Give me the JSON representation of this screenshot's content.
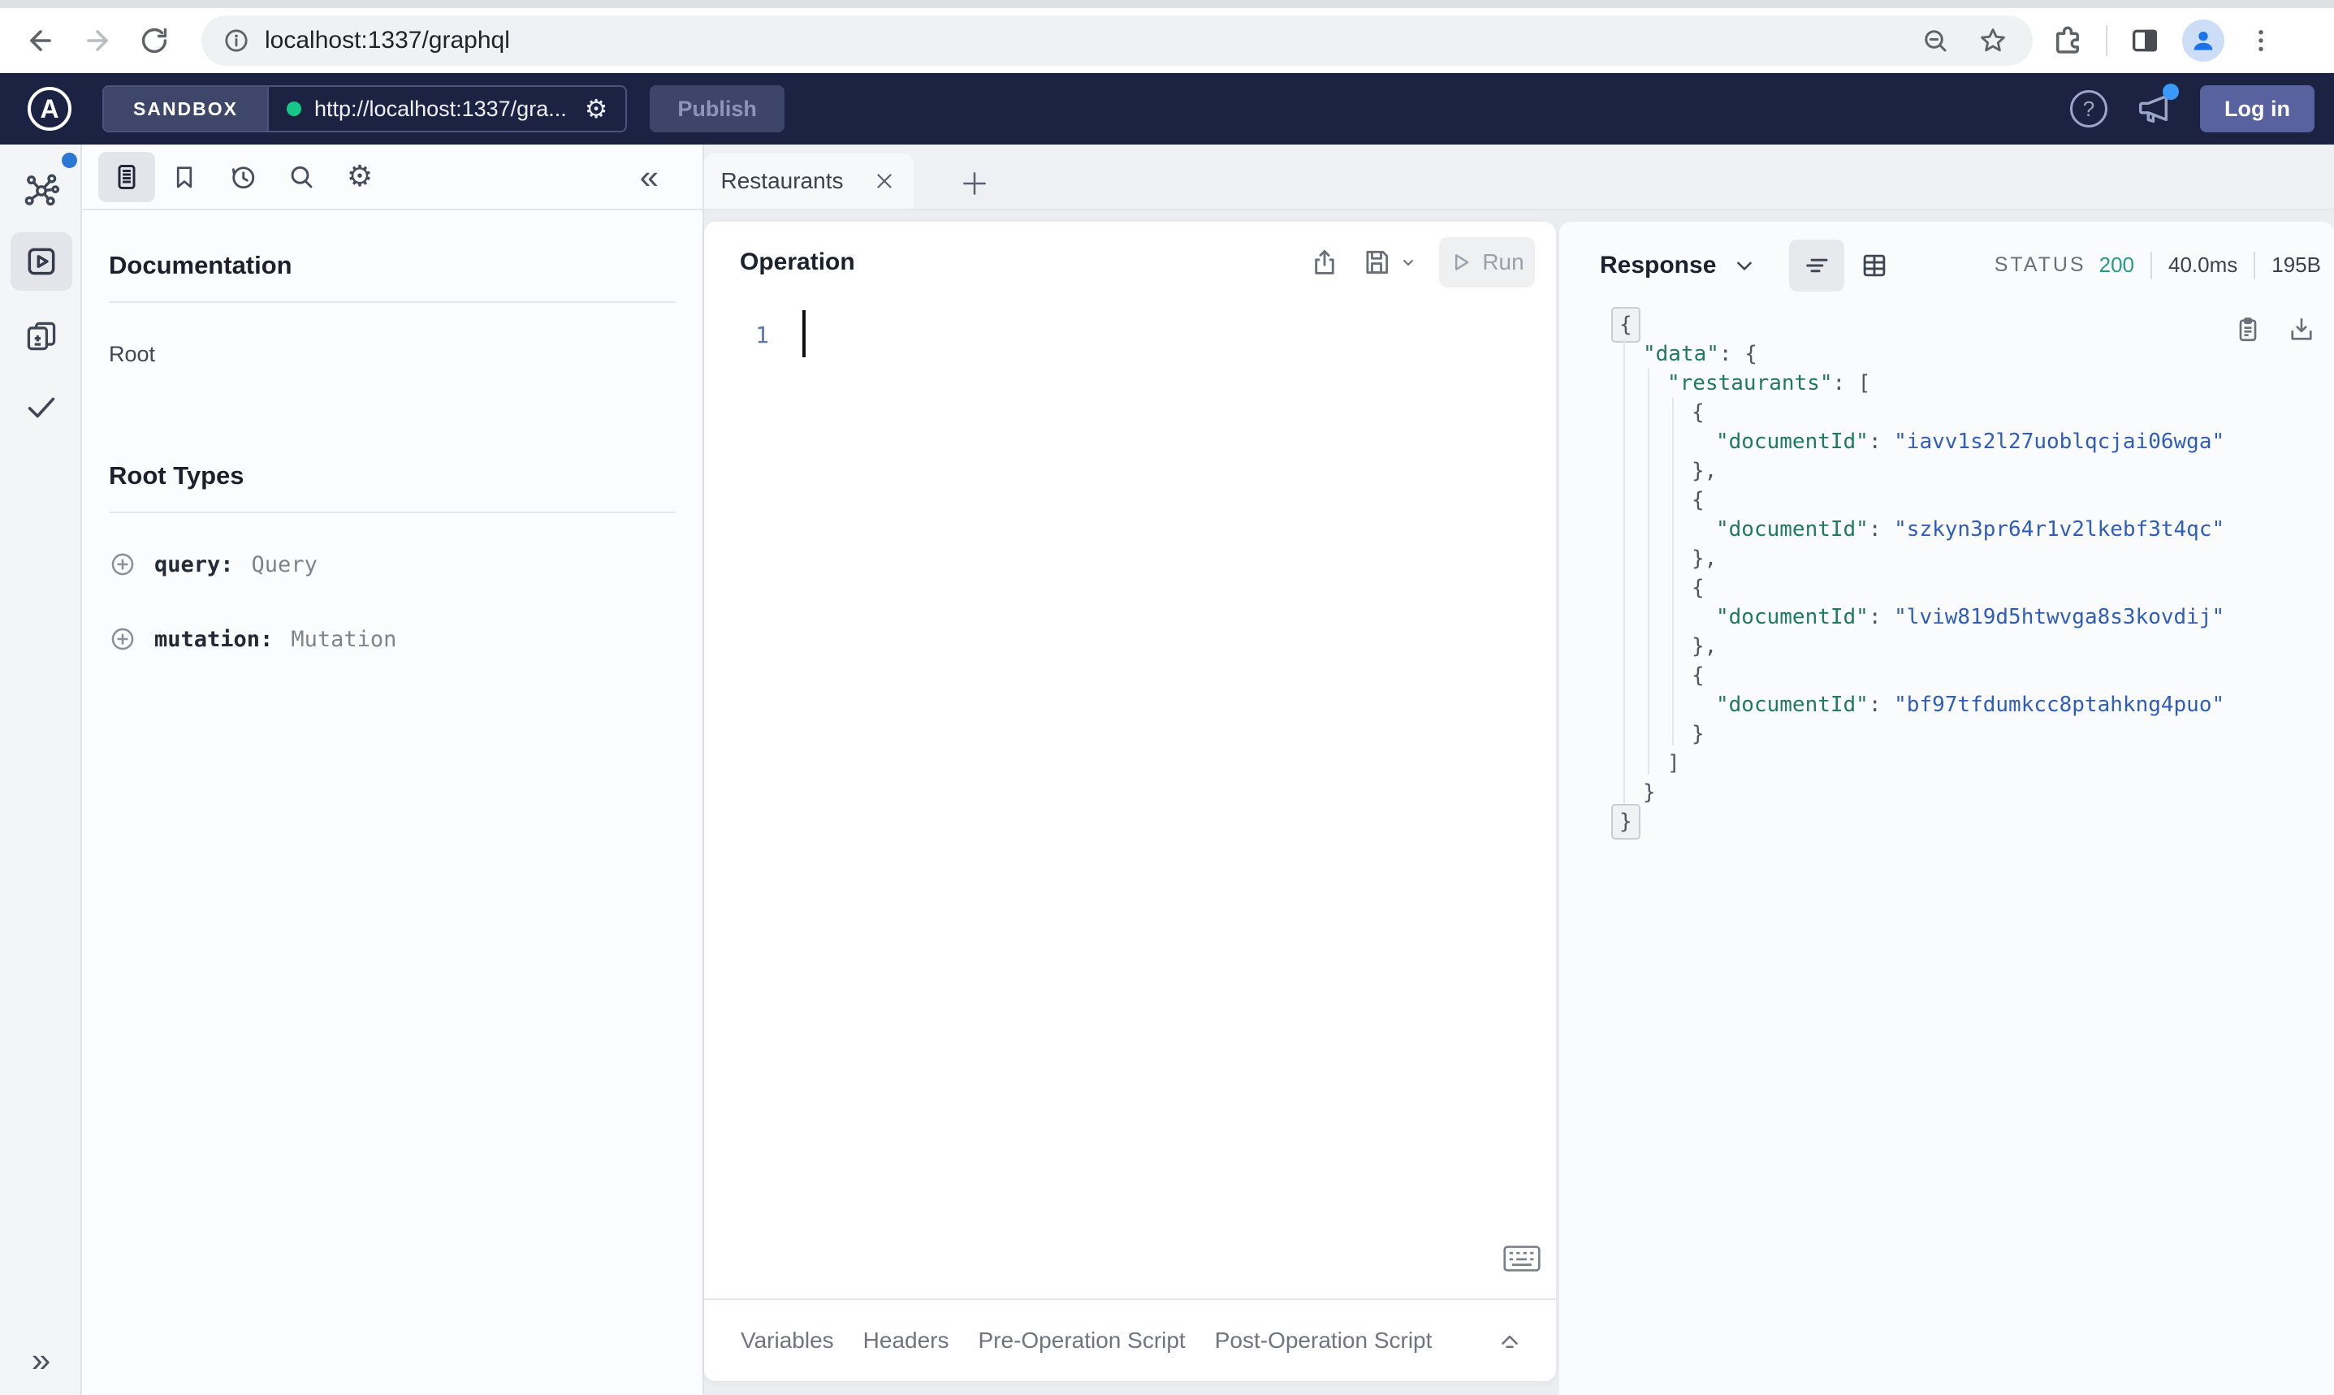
{
  "browser": {
    "url": "localhost:1337/graphql"
  },
  "appbar": {
    "logo_letter": "A",
    "env_label": "SANDBOX",
    "endpoint": "http://localhost:1337/gra...",
    "publish": "Publish",
    "help": "?",
    "login": "Log in"
  },
  "docs": {
    "title": "Documentation",
    "root_link": "Root",
    "root_types_title": "Root Types",
    "root_types": [
      {
        "field": "query:",
        "type": "Query"
      },
      {
        "field": "mutation:",
        "type": "Mutation"
      }
    ]
  },
  "tabs": {
    "active_tab": "Restaurants"
  },
  "operation": {
    "title": "Operation",
    "run": "Run",
    "line_number": "1"
  },
  "response": {
    "title": "Response",
    "status_label": "STATUS",
    "status_code": "200",
    "duration": "40.0ms",
    "size": "195B",
    "json_lines": [
      {
        "indent": 0,
        "boxed": true,
        "tokens": [
          [
            "p",
            "{"
          ]
        ]
      },
      {
        "indent": 1,
        "boxed": false,
        "tokens": [
          [
            "k",
            "\"data\""
          ],
          [
            "p",
            ": {"
          ]
        ]
      },
      {
        "indent": 2,
        "boxed": false,
        "tokens": [
          [
            "k",
            "\"restaurants\""
          ],
          [
            "p",
            ": ["
          ]
        ]
      },
      {
        "indent": 3,
        "boxed": false,
        "tokens": [
          [
            "p",
            "{"
          ]
        ]
      },
      {
        "indent": 4,
        "boxed": false,
        "tokens": [
          [
            "k",
            "\"documentId\""
          ],
          [
            "p",
            ": "
          ],
          [
            "s",
            "\"iavv1s2l27uoblqcjai06wga\""
          ]
        ]
      },
      {
        "indent": 3,
        "boxed": false,
        "tokens": [
          [
            "p",
            "},"
          ]
        ]
      },
      {
        "indent": 3,
        "boxed": false,
        "tokens": [
          [
            "p",
            "{"
          ]
        ]
      },
      {
        "indent": 4,
        "boxed": false,
        "tokens": [
          [
            "k",
            "\"documentId\""
          ],
          [
            "p",
            ": "
          ],
          [
            "s",
            "\"szkyn3pr64r1v2lkebf3t4qc\""
          ]
        ]
      },
      {
        "indent": 3,
        "boxed": false,
        "tokens": [
          [
            "p",
            "},"
          ]
        ]
      },
      {
        "indent": 3,
        "boxed": false,
        "tokens": [
          [
            "p",
            "{"
          ]
        ]
      },
      {
        "indent": 4,
        "boxed": false,
        "tokens": [
          [
            "k",
            "\"documentId\""
          ],
          [
            "p",
            ": "
          ],
          [
            "s",
            "\"lviw819d5htwvga8s3kovdij\""
          ]
        ]
      },
      {
        "indent": 3,
        "boxed": false,
        "tokens": [
          [
            "p",
            "},"
          ]
        ]
      },
      {
        "indent": 3,
        "boxed": false,
        "tokens": [
          [
            "p",
            "{"
          ]
        ]
      },
      {
        "indent": 4,
        "boxed": false,
        "tokens": [
          [
            "k",
            "\"documentId\""
          ],
          [
            "p",
            ": "
          ],
          [
            "s",
            "\"bf97tfdumkcc8ptahkng4puo\""
          ]
        ]
      },
      {
        "indent": 3,
        "boxed": false,
        "tokens": [
          [
            "p",
            "}"
          ]
        ]
      },
      {
        "indent": 2,
        "boxed": false,
        "tokens": [
          [
            "p",
            "]"
          ]
        ]
      },
      {
        "indent": 1,
        "boxed": false,
        "tokens": [
          [
            "p",
            "}"
          ]
        ]
      },
      {
        "indent": 0,
        "boxed": true,
        "tokens": [
          [
            "p",
            "}"
          ]
        ]
      }
    ]
  },
  "footer_tabs": [
    "Variables",
    "Headers",
    "Pre-Operation Script",
    "Post-Operation Script"
  ],
  "colors": {
    "appbar_bg": "#1c2342",
    "accent_green": "#17c787",
    "status_green": "#279a82",
    "notification_blue": "#3b9af8",
    "json_key": "#1f7a63",
    "json_string": "#2e5dbb",
    "login_bg": "#57629e"
  }
}
